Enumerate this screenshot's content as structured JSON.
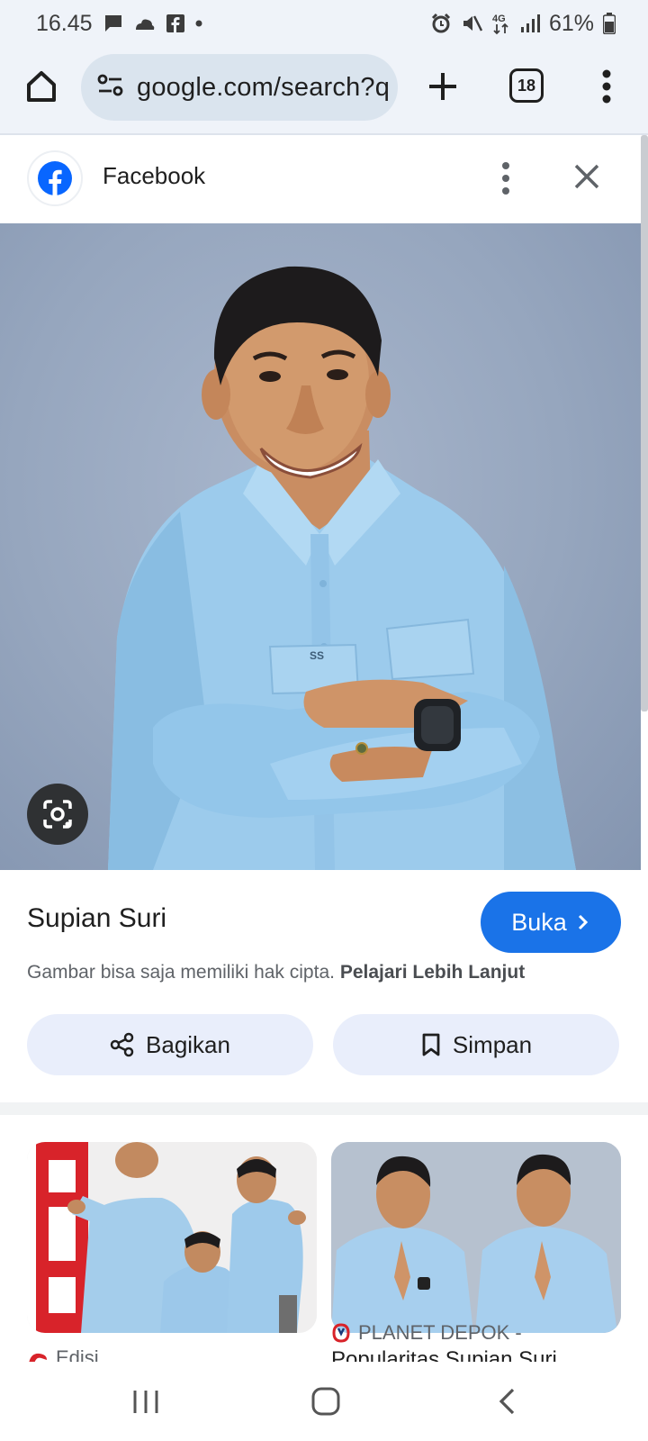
{
  "status_bar": {
    "time": "16.45",
    "battery": "61%",
    "network": "4G"
  },
  "toolbar": {
    "url": "google.com/search?q",
    "tab_count": "18"
  },
  "source": {
    "name": "Facebook"
  },
  "result": {
    "title": "Supian Suri",
    "open_label": "Buka",
    "copyright_text": "Gambar bisa saja memiliki hak cipta.",
    "learn_more": "Pelajari Lebih Lanjut",
    "share_label": "Bagikan",
    "save_label": "Simpan"
  },
  "image": {
    "pocket_label": "SS"
  },
  "related": [
    {
      "source": "Edisi"
    },
    {
      "source": "PLANET DEPOK -",
      "title": "Popularitas Supian Suri"
    }
  ],
  "colors": {
    "accent": "#1a73e8",
    "toolbar_bg": "#eff3f9",
    "url_pill": "#dae4ee",
    "pill_btn": "#e9eefb"
  }
}
